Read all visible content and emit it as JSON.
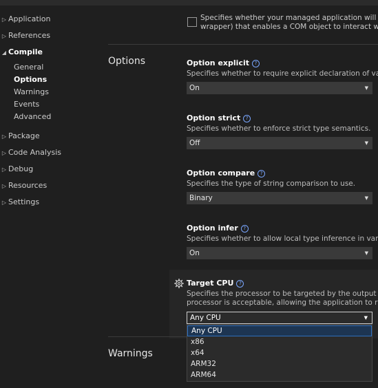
{
  "nav": {
    "items": [
      {
        "label": "Application",
        "expanded": false
      },
      {
        "label": "References",
        "expanded": false
      },
      {
        "label": "Compile",
        "expanded": true
      },
      {
        "label": "Package",
        "expanded": false
      },
      {
        "label": "Code Analysis",
        "expanded": false
      },
      {
        "label": "Debug",
        "expanded": false
      },
      {
        "label": "Resources",
        "expanded": false
      },
      {
        "label": "Settings",
        "expanded": false
      }
    ],
    "compile_children": [
      {
        "label": "General",
        "selected": false
      },
      {
        "label": "Options",
        "selected": true
      },
      {
        "label": "Warnings",
        "selected": false
      },
      {
        "label": "Events",
        "selected": false
      },
      {
        "label": "Advanced",
        "selected": false
      }
    ]
  },
  "com_visible": {
    "line1": "Specifies whether your managed application will expos",
    "line2": "wrapper) that enables a COM object to interact with th",
    "checked": false
  },
  "options_section": {
    "title": "Options",
    "option_explicit": {
      "title": "Option explicit",
      "desc": "Specifies whether to require explicit declaration of variables",
      "value": "On"
    },
    "option_strict": {
      "title": "Option strict",
      "desc": "Specifies whether to enforce strict type semantics.",
      "value": "Off"
    },
    "option_compare": {
      "title": "Option compare",
      "desc": "Specifies the type of string comparison to use.",
      "value": "Binary"
    },
    "option_infer": {
      "title": "Option infer",
      "desc": "Specifies whether to allow local type inference in variable d",
      "value": "On"
    },
    "target_cpu": {
      "title": "Target CPU",
      "desc_line1": "Specifies the processor to be targeted by the output file. Ch",
      "desc_line2": "processor is acceptable, allowing the application to run on",
      "value": "Any CPU",
      "options": [
        "Any CPU",
        "x86",
        "x64",
        "ARM32",
        "ARM64"
      ],
      "selected_index": 0
    }
  },
  "warnings_section": {
    "title": "Warnings"
  },
  "icons": {
    "help": "question-circle-icon",
    "gear": "gear-icon",
    "chevron_right": "chevron-right-icon",
    "chevron_down": "chevron-down-icon"
  },
  "colors": {
    "background": "#1f1f1f",
    "combo_bg": "#3a3a3a",
    "selection": "#1d3552",
    "accent": "#7aa7ff"
  }
}
